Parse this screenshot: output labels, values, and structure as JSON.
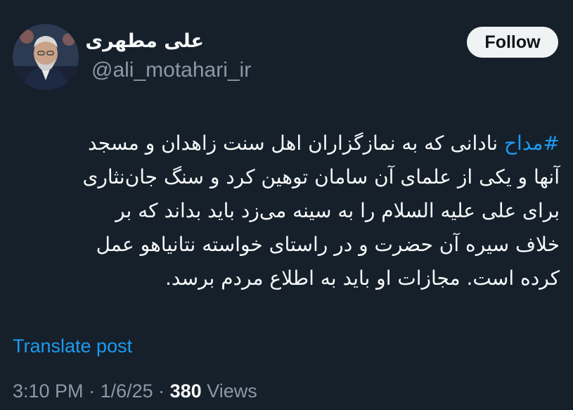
{
  "author": {
    "name": "علی مطهری",
    "handle": "@ali_motahari_ir"
  },
  "follow_label": "Follow",
  "tweet": {
    "hashtag": "#مداح",
    "line1_rest": " نادانی که به نمازگزاران اهل سنت زاهدان و مسجد",
    "line2": "آنها و یکی از علمای آن سامان توهین کرد و سنگ جان‌نثاری",
    "line3": "برای علی علیه السلام را به سینه می‌زد باید بداند که بر",
    "line4": "خلاف سیره آن حضرت و در راستای خواسته نتانیاهو عمل",
    "line5": "کرده است. مجازات او باید به اطلاع مردم برسد."
  },
  "translate_label": "Translate post",
  "meta": {
    "time": "3:10 PM",
    "separator": " · ",
    "date": "1/6/25",
    "views_count": "380",
    "views_label": " Views"
  },
  "colors": {
    "background": "#15202b",
    "link": "#1d9bf0",
    "secondary_text": "#8b98a5",
    "primary_text": "#f7f9f9"
  }
}
